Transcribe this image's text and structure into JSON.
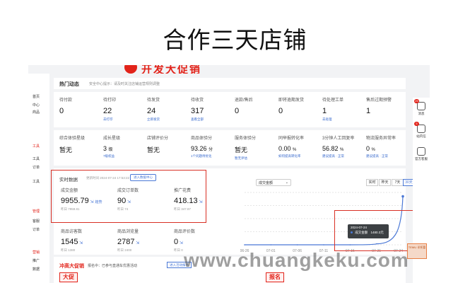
{
  "headline": "合作三天店铺",
  "banner": {
    "text": "开发大促销"
  },
  "sidebar": [
    {
      "label": "首页",
      "red": false
    },
    {
      "label": "中心",
      "red": false
    },
    {
      "label": "商品",
      "red": false
    },
    {
      "label": "工具",
      "red": true
    },
    {
      "label": "工具",
      "red": false
    },
    {
      "label": "订单",
      "red": false
    },
    {
      "label": "工具",
      "red": false
    },
    {
      "label": "管理",
      "red": true
    },
    {
      "label": "客服",
      "red": false
    },
    {
      "label": "订单",
      "red": false
    },
    {
      "label": "营销",
      "red": true
    },
    {
      "label": "推广",
      "red": false
    },
    {
      "label": "数据",
      "red": false
    }
  ],
  "topnav": {
    "title": "热门动态",
    "notice": "安全中心提示：请及时关注店铺运营规则调整"
  },
  "orders": [
    {
      "label": "待付款",
      "value": "0",
      "sub": ""
    },
    {
      "label": "待打印",
      "value": "22",
      "sub": "去打印"
    },
    {
      "label": "待发货",
      "value": "24",
      "sub": "立即发货"
    },
    {
      "label": "待收货",
      "value": "317",
      "sub": "查看全部"
    },
    {
      "label": "退款/售后",
      "value": "0",
      "sub": ""
    },
    {
      "label": "即将逾期发货",
      "value": "0",
      "sub": ""
    },
    {
      "label": "待处理工单",
      "value": "1",
      "sub": "去处理"
    },
    {
      "label": "售后过期预警",
      "value": "1",
      "sub": ""
    }
  ],
  "scores": [
    {
      "label": "综合体验星级",
      "value": "暂无",
      "unit": "",
      "sub": ""
    },
    {
      "label": "成长星级",
      "value": "3",
      "unit": "级",
      "sub": "7级权益"
    },
    {
      "label": "店铺评价分",
      "value": "暂无",
      "unit": "",
      "sub": ""
    },
    {
      "label": "商品体验分",
      "value": "93.26",
      "unit": "分",
      "sub": "1个问题待优化"
    },
    {
      "label": "服务体验分",
      "value": "暂无",
      "unit": "",
      "sub": "暂无评估"
    },
    {
      "label": "同举报转化率",
      "value": "0.00",
      "unit": "%",
      "sub": "如何提高转化率"
    },
    {
      "label": "3分钟人工回复率",
      "value": "56.82",
      "unit": "%",
      "sub": "建议提高 · 正常"
    },
    {
      "label": "物流服务异常率",
      "value": "0",
      "unit": "%",
      "sub": "建议提高 · 正常"
    }
  ],
  "realtime": {
    "title": "实时数据",
    "time": "更新时间 2024-07-24 17:53:22",
    "button": "进入数据中心",
    "metrics": [
      {
        "label": "成交金额",
        "value": "9955.79",
        "link": "趋势",
        "prev": "昨日 7959.81"
      },
      {
        "label": "成交订单数",
        "value": "90",
        "link": "",
        "prev": "昨日 74"
      },
      {
        "label": "推广花费",
        "value": "418.13",
        "link": "",
        "prev": "昨日 347.87"
      },
      {
        "label": "商品访客数",
        "value": "1545",
        "link": "",
        "prev": "昨日 1380"
      },
      {
        "label": "商品浏览量",
        "value": "2787",
        "link": "",
        "prev": "昨日 2400"
      },
      {
        "label": "商品评价数",
        "value": "0",
        "link": "",
        "prev": "昨日 0"
      }
    ]
  },
  "chart_controls": {
    "select": "成交金额",
    "ranges": [
      "实时",
      "昨天",
      "7天",
      "30天"
    ],
    "active": "30天"
  },
  "chart_data": {
    "type": "line",
    "x": [
      "06-26",
      "07-01",
      "07-06",
      "07-11",
      "07-16",
      "07-21",
      "07-24"
    ],
    "values": [
      0,
      0,
      0,
      0,
      0,
      30,
      1480.3
    ],
    "ylim": [
      0,
      1600
    ],
    "ylabel": "",
    "xlabel": "",
    "series_color": "#4a78d6",
    "grid": true,
    "tooltip": {
      "date": "2024-07-24",
      "label": "成交金额",
      "value": "1480.3元"
    }
  },
  "right_panel": [
    {
      "label": "消息",
      "badge": "25"
    },
    {
      "label": "站内信",
      "badge": "5"
    },
    {
      "label": "官方客服",
      "badge": ""
    }
  ],
  "promo": {
    "title": "冲高大促销",
    "notice": "报名中：已参与直通车优惠活动",
    "button": "进入活动报名",
    "tag_left": "大促",
    "tag_right": "报名"
  },
  "temu": "TEMU 半托管",
  "watermark": "www.chuangkeku.com"
}
